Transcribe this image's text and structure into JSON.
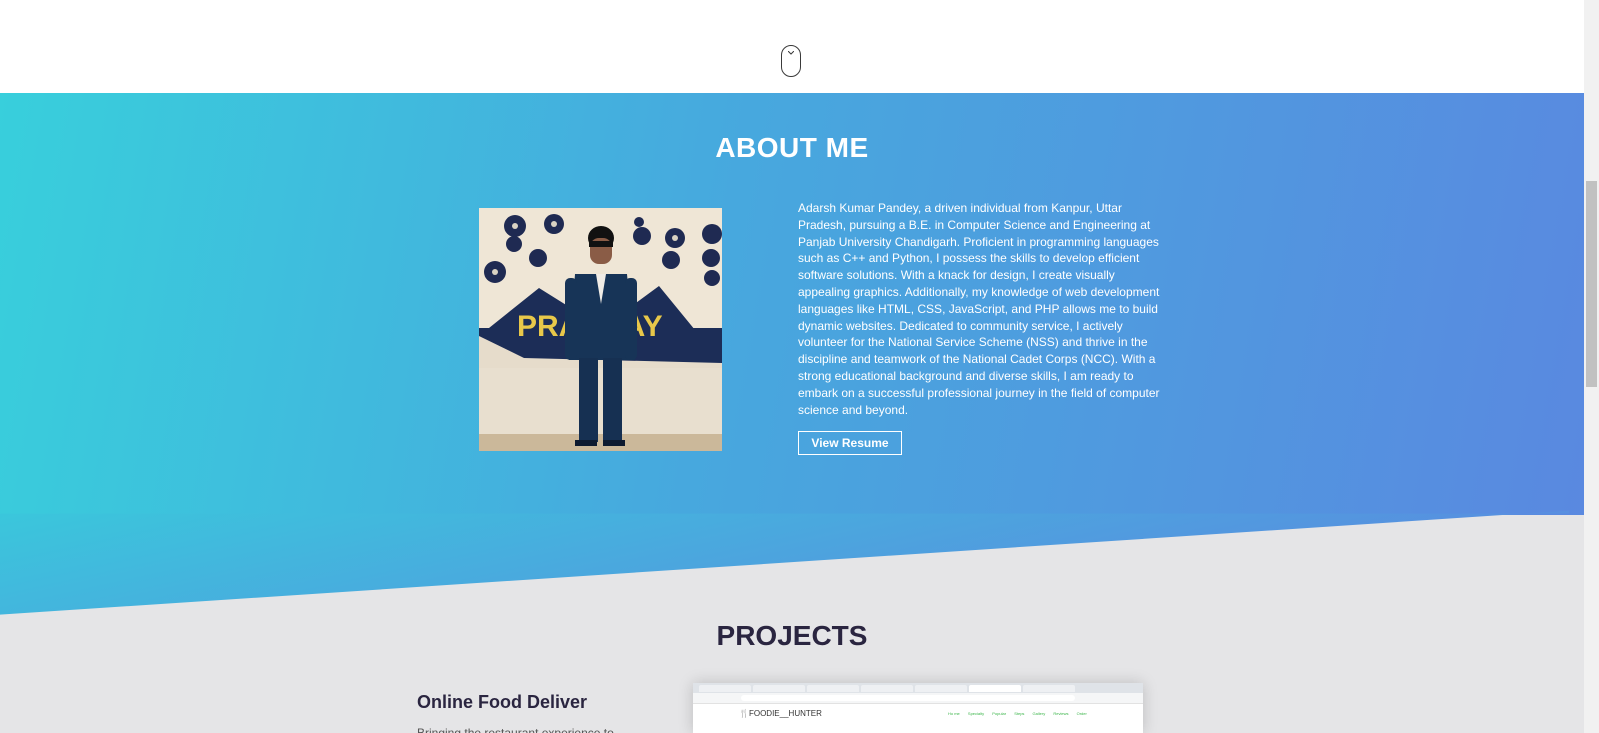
{
  "about": {
    "title": "ABOUT ME",
    "photo_banner_text": "PRABHAY",
    "description": "Adarsh Kumar Pandey, a driven individual from Kanpur, Uttar Pradesh, pursuing a B.E. in Computer Science and Engineering at Panjab University Chandigarh. Proficient in programming languages such as C++ and Python, I possess the skills to develop efficient software solutions. With a knack for design, I create visually appealing graphics. Additionally, my knowledge of web development languages like HTML, CSS, JavaScript, and PHP allows me to build dynamic websites. Dedicated to community service, I actively volunteer for the National Service Scheme (NSS) and thrive in the discipline and teamwork of the National Cadet Corps (NCC). With a strong educational background and diverse skills, I am ready to embark on a successful professional journey in the field of computer science and beyond.",
    "resume_button": "View Resume"
  },
  "projects": {
    "title": "PROJECTS",
    "items": [
      {
        "title": "Online Food Deliver",
        "description": "Bringing the restaurant experience to",
        "screenshot": {
          "logo": "FOODIE__HUNTER",
          "nav": [
            "Ho me",
            "Specialty",
            "Popular",
            "Steps",
            "Gallery",
            "Reviews",
            "Order"
          ]
        }
      }
    ]
  },
  "colors": {
    "gradient_start": "#38cfdc",
    "gradient_end": "#5a88e0",
    "projects_bg": "#e5e5e7",
    "heading_dark": "#2a2540"
  },
  "icons": [
    "mouse-scroll-icon",
    "fork-knife-icon"
  ]
}
